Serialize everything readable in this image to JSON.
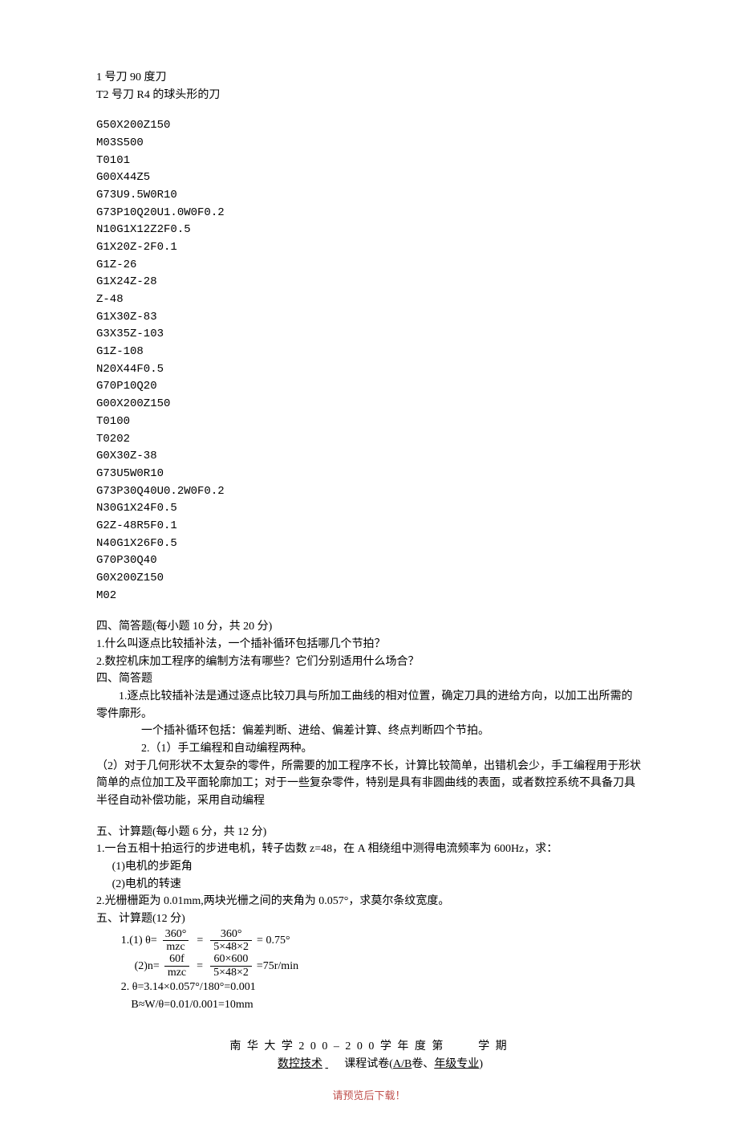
{
  "intro": {
    "line1": "1 号刀 90 度刀",
    "line2": "T2 号刀 R4 的球头形的刀"
  },
  "code": [
    "G50X200Z150",
    "M03S500",
    "T0101",
    "G00X44Z5",
    "G73U9.5W0R10",
    "G73P10Q20U1.0W0F0.2",
    "N10G1X12Z2F0.5",
    "G1X20Z-2F0.1",
    "G1Z-26",
    "G1X24Z-28",
    "Z-48",
    "G1X30Z-83",
    "G3X35Z-103",
    "G1Z-108",
    "N20X44F0.5",
    "G70P10Q20",
    "G00X200Z150",
    "T0100",
    "T0202",
    "G0X30Z-38",
    "G73U5W0R10",
    "G73P30Q40U0.2W0F0.2",
    "N30G1X24F0.5",
    "G2Z-48R5F0.1",
    "N40G1X26F0.5",
    "G70P30Q40",
    "G0X200Z150",
    "M02"
  ],
  "section4": {
    "heading": "四、简答题(每小题 10 分，共 20 分)",
    "q1": "1.什么叫逐点比较插补法，一个插补循环包括哪几个节拍？",
    "q2": "2.数控机床加工程序的编制方法有哪些？它们分别适用什么场合？",
    "ans_heading": "四、简答题",
    "a1_p1": "1.逐点比较插补法是通过逐点比较刀具与所加工曲线的相对位置，确定刀具的进给方向，以加工出所需的零件廓形。",
    "a1_p2": "一个插补循环包括：偏差判断、进给、偏差计算、终点判断四个节拍。",
    "a2_p1": "2.（1）手工编程和自动编程两种。",
    "a2_p2": "（2）对于几何形状不太复杂的零件，所需要的加工程序不长，计算比较简单，出错机会少，手工编程用于形状简单的点位加工及平面轮廓加工；对于一些复杂零件，特别是具有非圆曲线的表面，或者数控系统不具备刀具半径自动补偿功能，采用自动编程"
  },
  "section5": {
    "heading": "五、计算题(每小题 6 分，共 12 分)",
    "q1": "1.一台五相十拍运行的步进电机，转子齿数 z=48，在 A 相绕组中测得电流频率为 600Hz，求：",
    "q1_a": "(1)电机的步距角",
    "q1_b": "(2)电机的转速",
    "q2": "2.光栅栅距为 0.01mm,两块光栅之间的夹角为 0.057°，求莫尔条纹宽度。",
    "ans_heading": "五、计算题(12 分)",
    "f1_prefix": "1.(1) θ=",
    "f1_num1": "360°",
    "f1_den1": "mzc",
    "f1_num2": "360°",
    "f1_den2": "5×48×2",
    "f1_result": "= 0.75°",
    "f2_prefix": "(2)n=",
    "f2_num1": "60f",
    "f2_den1": "mzc",
    "f2_num2": "60×600",
    "f2_den2": "5×48×2",
    "f2_result": "=75r/min",
    "a2_l1": "2. θ=3.14×0.057°/180°=0.001",
    "a2_l2": "B≈W/θ=0.01/0.001=10mm"
  },
  "footer": {
    "line1_a": "南 华 大 学  2 0 0   –  2 0 0   学 年 度 第",
    "line1_b": "学 期",
    "line2_a": "数控技术",
    "line2_b": "课程试卷(",
    "line2_c": "A/B",
    "line2_d": "卷、",
    "line2_e": "年级专业",
    "line2_f": ")",
    "note": "请预览后下载！"
  }
}
